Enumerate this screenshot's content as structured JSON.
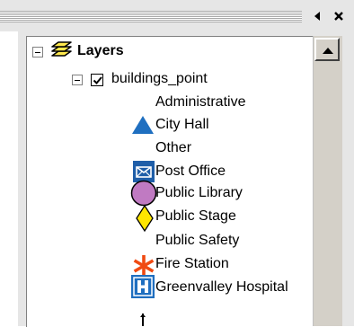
{
  "toc": {
    "root": {
      "label": "Layers"
    },
    "layer": {
      "label": "buildings_point",
      "checked": true
    },
    "items": [
      {
        "type": "heading",
        "label": "Administrative"
      },
      {
        "type": "symbol",
        "label": "City Hall",
        "icon": "blue-triangle-icon"
      },
      {
        "type": "heading",
        "label": "Other"
      },
      {
        "type": "symbol",
        "label": "Post Office",
        "icon": "envelope-icon"
      },
      {
        "type": "symbol",
        "label": "Public Library",
        "icon": "purple-circle-icon"
      },
      {
        "type": "symbol",
        "label": "Public Stage",
        "icon": "yellow-diamond-icon"
      },
      {
        "type": "heading",
        "label": "Public Safety"
      },
      {
        "type": "symbol",
        "label": "Fire Station",
        "icon": "red-asterisk-icon"
      },
      {
        "type": "symbol",
        "label": "Greenvalley Hospital",
        "icon": "hospital-icon"
      }
    ]
  },
  "colors": {
    "city_hall": "#1f6fc0",
    "post_office": "#1f5ea8",
    "public_library": "#c07ac2",
    "public_stage": "#ffe600",
    "fire_station": "#f04a12",
    "hospital": "#1f6fc0"
  }
}
